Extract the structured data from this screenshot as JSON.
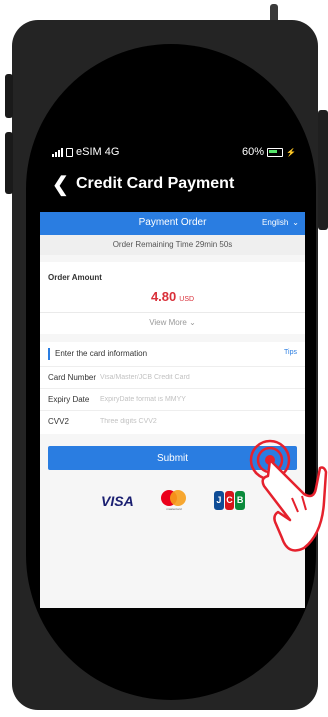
{
  "status": {
    "carrier": "eSIM 4G",
    "battery": "60%"
  },
  "header": {
    "back_icon": "chevron-left-icon",
    "title": "Credit Card Payment"
  },
  "order": {
    "title": "Payment Order",
    "language": "English",
    "remaining": "Order Remaining Time 29min 50s",
    "amount_label": "Order Amount",
    "amount": "4.80",
    "currency": "USD",
    "view_more": "View More"
  },
  "card": {
    "heading": "Enter the card information",
    "tips": "Tips",
    "fields": [
      {
        "label": "Card Number",
        "placeholder": "Visa/Master/JCB Credit Card"
      },
      {
        "label": "Expiry Date",
        "placeholder": "ExpiryDate format is MMYY"
      },
      {
        "label": "CVV2",
        "placeholder": "Three digits CVV2"
      }
    ]
  },
  "submit_label": "Submit",
  "logos": {
    "visa": "VISA",
    "mastercard": "mastercard",
    "jcb": [
      "J",
      "C",
      "B"
    ]
  },
  "colors": {
    "accent": "#2a7de1",
    "amount": "#d9303a",
    "hand": "#e5212d"
  }
}
